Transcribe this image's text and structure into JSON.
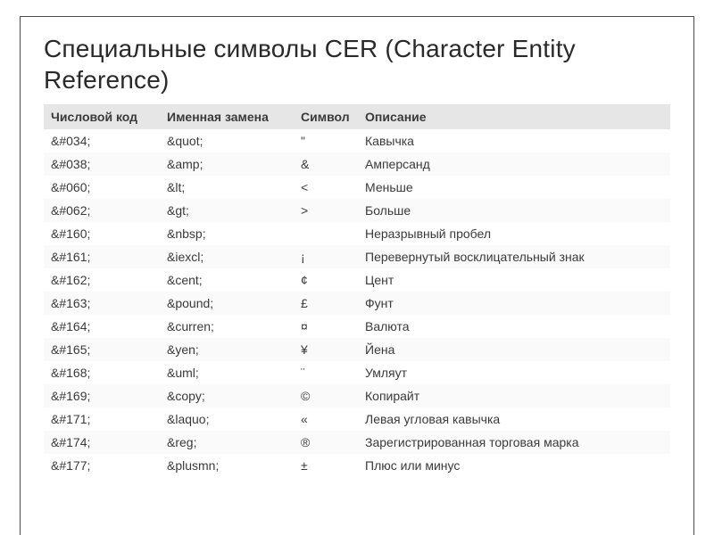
{
  "title": "Специальные символы CER (Character Entity Reference)",
  "columns": [
    "Числовой код",
    "Именная замена",
    "Символ",
    "Описание"
  ],
  "rows": [
    {
      "code": "&#034;",
      "name": "&quot;",
      "symbol": "\"",
      "desc": "Кавычка"
    },
    {
      "code": "&#038;",
      "name": "&amp;",
      "symbol": "&",
      "desc": "Амперсанд"
    },
    {
      "code": "&#060;",
      "name": "&lt;",
      "symbol": "<",
      "desc": "Меньше"
    },
    {
      "code": "&#062;",
      "name": "&gt;",
      "symbol": ">",
      "desc": "Больше"
    },
    {
      "code": "&#160;",
      "name": "&nbsp;",
      "symbol": " ",
      "desc": "Неразрывный пробел"
    },
    {
      "code": "&#161;",
      "name": "&iexcl;",
      "symbol": "¡",
      "desc": "Перевернутый восклицательный знак"
    },
    {
      "code": "&#162;",
      "name": "&cent;",
      "symbol": "¢",
      "desc": "Цент"
    },
    {
      "code": "&#163;",
      "name": "&pound;",
      "symbol": "£",
      "desc": "Фунт"
    },
    {
      "code": "&#164;",
      "name": "&curren;",
      "symbol": "¤",
      "desc": "Валюта"
    },
    {
      "code": "&#165;",
      "name": "&yen;",
      "symbol": "¥",
      "desc": "Йена"
    },
    {
      "code": "&#168;",
      "name": "&uml;",
      "symbol": "¨",
      "desc": "Умляут"
    },
    {
      "code": "&#169;",
      "name": "&copy;",
      "symbol": "©",
      "desc": "Копирайт"
    },
    {
      "code": "&#171;",
      "name": "&laquo;",
      "symbol": "«",
      "desc": "Левая угловая кавычка"
    },
    {
      "code": "&#174;",
      "name": "&reg;",
      "symbol": "®",
      "desc": "Зарегистрированная торговая марка"
    },
    {
      "code": "&#177;",
      "name": "&plusmn;",
      "symbol": "±",
      "desc": "Плюс или минус"
    }
  ]
}
